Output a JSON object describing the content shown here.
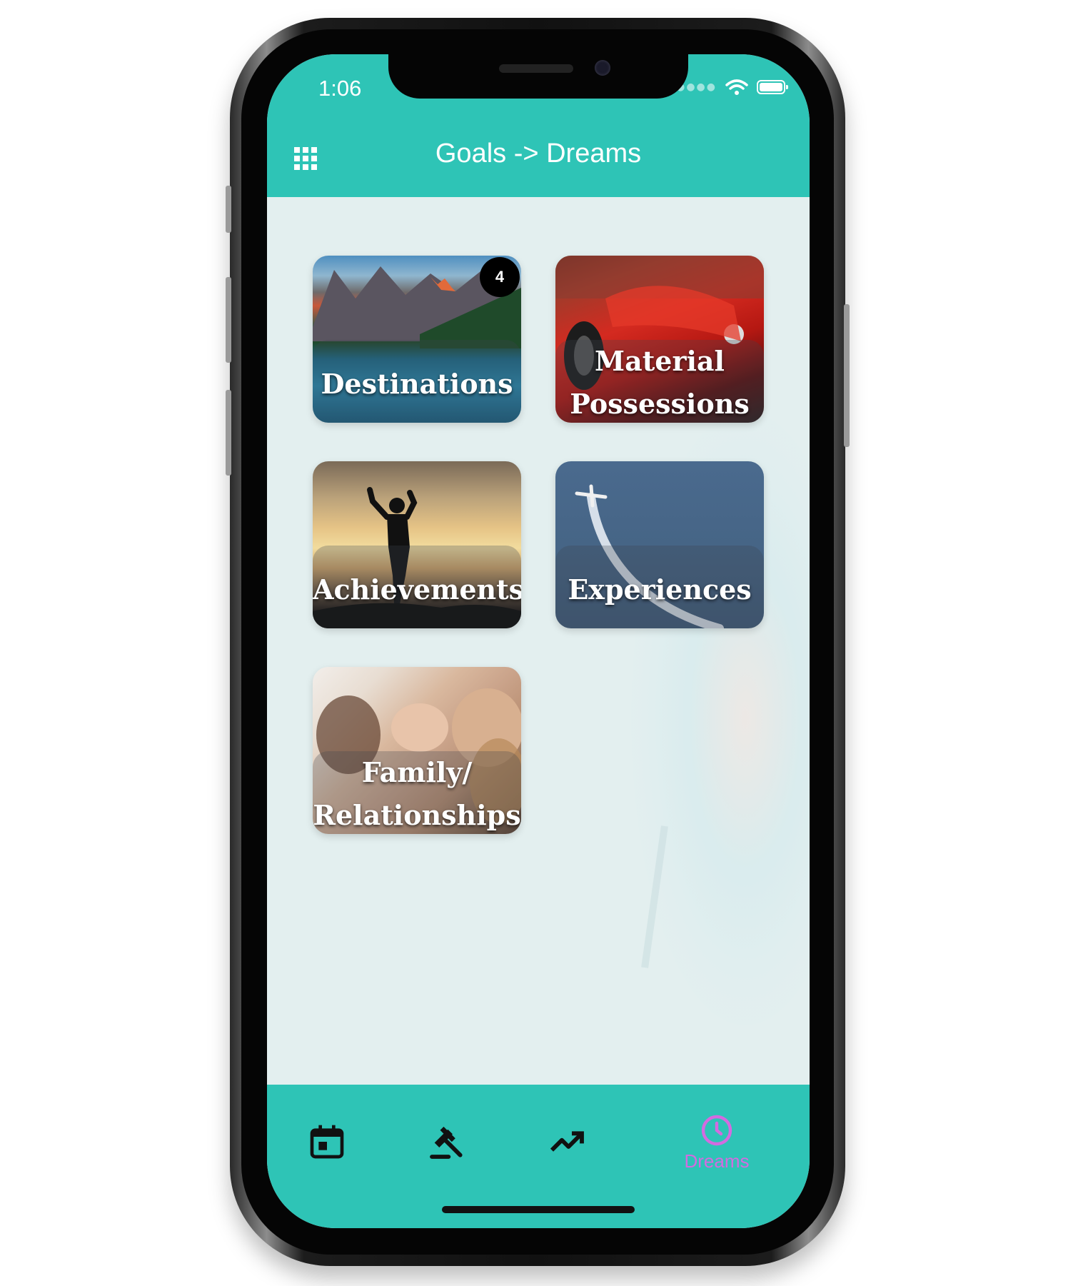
{
  "status_bar": {
    "time": "1:06"
  },
  "header": {
    "title": "Goals -> Dreams",
    "menu_icon": "apps-grid-icon"
  },
  "categories": [
    {
      "label": "Destinations",
      "badge": "4"
    },
    {
      "label_line1": "Material",
      "label_line2": "Possessions"
    },
    {
      "label": "Achievements"
    },
    {
      "label": "Experiences"
    },
    {
      "label_line1": "Family/",
      "label_line2": "Relationships"
    }
  ],
  "tabs": [
    {
      "icon": "calendar-icon"
    },
    {
      "icon": "gavel-icon"
    },
    {
      "icon": "trending-up-icon"
    },
    {
      "icon": "clock-icon",
      "label": "Dreams",
      "active": true
    }
  ],
  "colors": {
    "accent": "#2ec4b6",
    "active_tab": "#d36be0",
    "background": "#e3efef"
  }
}
